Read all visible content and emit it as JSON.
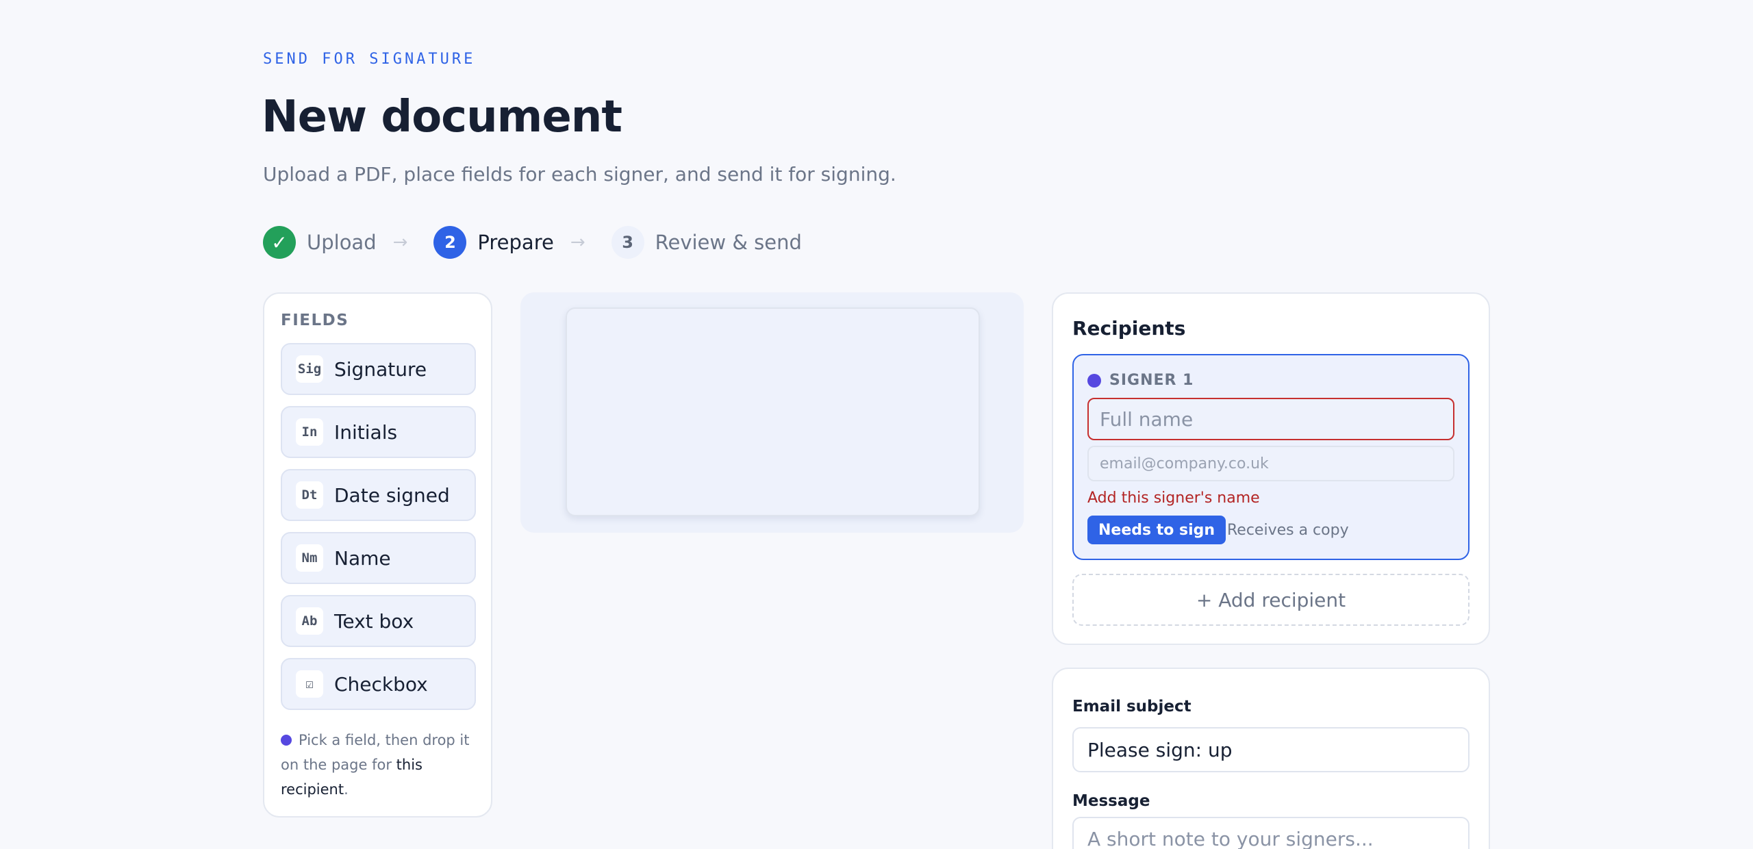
{
  "header": {
    "eyebrow": "SEND FOR SIGNATURE",
    "title": "New document",
    "subtitle": "Upload a PDF, place fields for each signer, and send it for signing."
  },
  "stepper": {
    "arrow": "→",
    "steps": [
      {
        "marker": "✓",
        "label": "Upload",
        "state": "done"
      },
      {
        "marker": "2",
        "label": "Prepare",
        "state": "current"
      },
      {
        "marker": "3",
        "label": "Review & send",
        "state": "todo"
      }
    ]
  },
  "fields": {
    "heading": "FIELDS",
    "items": [
      {
        "badge": "Sig",
        "label": "Signature"
      },
      {
        "badge": "In",
        "label": "Initials"
      },
      {
        "badge": "Dt",
        "label": "Date signed"
      },
      {
        "badge": "Nm",
        "label": "Name"
      },
      {
        "badge": "Ab",
        "label": "Text box"
      },
      {
        "badge": "☑",
        "label": "Checkbox"
      }
    ],
    "tip_before": "Pick a field, then drop it on the page for ",
    "tip_emphasis": "this recipient",
    "tip_after": "."
  },
  "recipients": {
    "title": "Recipients",
    "signer_label": "SIGNER 1",
    "signer_color": "#5648e0",
    "name_placeholder": "Full name",
    "email_placeholder": "email@company.co.uk",
    "error": "Add this signer's name",
    "role_selected": "Needs to sign",
    "role_other": "Receives a copy",
    "add_button": "+ Add recipient"
  },
  "email": {
    "subject_label": "Email subject",
    "subject_value": "Please sign: up",
    "message_label": "Message",
    "message_placeholder": "A short note to your signers..."
  },
  "colors": {
    "accent": "#2f63e6",
    "success": "#23a05a",
    "error": "#c62f2f"
  }
}
